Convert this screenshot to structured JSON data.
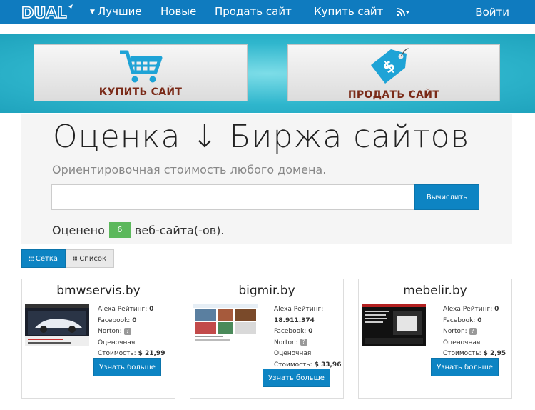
{
  "nav": {
    "logo_text": "DUAL",
    "items": [
      "Лучшие",
      "Новые",
      "Продать сайт",
      "Купить сайт"
    ],
    "login": "Войти",
    "rss_icon": "rss-icon"
  },
  "hero": {
    "buy_label": "КУПИТЬ САЙТ",
    "sell_label": "ПРОДАТЬ САЙТ",
    "tag_symbol": "$"
  },
  "panel": {
    "title": "Оценка ↓ Биржа сайтов",
    "subtitle": "Ориентировочная стоимость любого домена.",
    "input_value": "",
    "input_placeholder": "",
    "calc_button": "Вычислить",
    "evaluated_prefix": "Оценено",
    "evaluated_count": "6",
    "evaluated_suffix": "веб-сайта(-ов)."
  },
  "view_toggle": {
    "grid": "Сетка",
    "list": "Список"
  },
  "sites": [
    {
      "name": "bmwservis.by",
      "alexa_label": "Alexa Рейтинг:",
      "alexa_value": "0",
      "facebook_label": "Facebook:",
      "facebook_value": "0",
      "norton_label": "Norton:",
      "value_label": "Оценочная",
      "cost_label": "Стоимость:",
      "cost_value": "$ 21,99",
      "button": "Узнать больше"
    },
    {
      "name": "bigmir.by",
      "alexa_label": "Alexa Рейтинг:",
      "alexa_value": "18.911.374",
      "facebook_label": "Facebook:",
      "facebook_value": "0",
      "norton_label": "Norton:",
      "value_label": "Оценочная",
      "cost_label": "Стоимость:",
      "cost_value": "$ 33,96",
      "button": "Узнать больше"
    },
    {
      "name": "mebelir.by",
      "alexa_label": "Alexa Рейтинг:",
      "alexa_value": "0",
      "facebook_label": "Facebook:",
      "facebook_value": "0",
      "norton_label": "Norton:",
      "value_label": "Оценочная",
      "cost_label": "Стоимость:",
      "cost_value": "$ 2,95",
      "button": "Узнать больше"
    }
  ]
}
